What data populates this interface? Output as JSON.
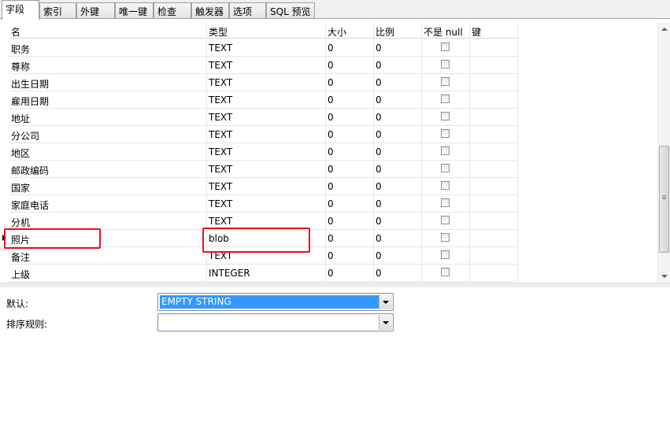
{
  "tabs": [
    "字段",
    "索引",
    "外键",
    "唯一键",
    "检查",
    "触发器",
    "选项",
    "SQL 预览"
  ],
  "active_tab": "字段",
  "columns": [
    "名",
    "类型",
    "大小",
    "比例",
    "不是 null",
    "键"
  ],
  "rows": [
    {
      "name": "职务",
      "type": "TEXT",
      "size": "0",
      "scale": "0",
      "not_null": false,
      "key": ""
    },
    {
      "name": "尊称",
      "type": "TEXT",
      "size": "0",
      "scale": "0",
      "not_null": false,
      "key": ""
    },
    {
      "name": "出生日期",
      "type": "TEXT",
      "size": "0",
      "scale": "0",
      "not_null": false,
      "key": ""
    },
    {
      "name": "雇用日期",
      "type": "TEXT",
      "size": "0",
      "scale": "0",
      "not_null": false,
      "key": ""
    },
    {
      "name": "地址",
      "type": "TEXT",
      "size": "0",
      "scale": "0",
      "not_null": false,
      "key": ""
    },
    {
      "name": "分公司",
      "type": "TEXT",
      "size": "0",
      "scale": "0",
      "not_null": false,
      "key": ""
    },
    {
      "name": "地区",
      "type": "TEXT",
      "size": "0",
      "scale": "0",
      "not_null": false,
      "key": ""
    },
    {
      "name": "邮政编码",
      "type": "TEXT",
      "size": "0",
      "scale": "0",
      "not_null": false,
      "key": ""
    },
    {
      "name": "国家",
      "type": "TEXT",
      "size": "0",
      "scale": "0",
      "not_null": false,
      "key": ""
    },
    {
      "name": "家庭电话",
      "type": "TEXT",
      "size": "0",
      "scale": "0",
      "not_null": false,
      "key": ""
    },
    {
      "name": "分机",
      "type": "TEXT",
      "size": "0",
      "scale": "0",
      "not_null": false,
      "key": ""
    },
    {
      "name": "照片",
      "type": "blob",
      "size": "0",
      "scale": "0",
      "not_null": false,
      "key": "",
      "current": true,
      "highlighted": true
    },
    {
      "name": "备注",
      "type": "TEXT",
      "size": "0",
      "scale": "0",
      "not_null": false,
      "key": ""
    },
    {
      "name": "上级",
      "type": "INTEGER",
      "size": "0",
      "scale": "0",
      "not_null": false,
      "key": ""
    }
  ],
  "properties": {
    "default_label": "默认:",
    "default_value": "EMPTY STRING",
    "collation_label": "排序规则:",
    "collation_value": ""
  },
  "colors": {
    "highlight_box": "#e8101d",
    "selection": "#3399ff"
  }
}
